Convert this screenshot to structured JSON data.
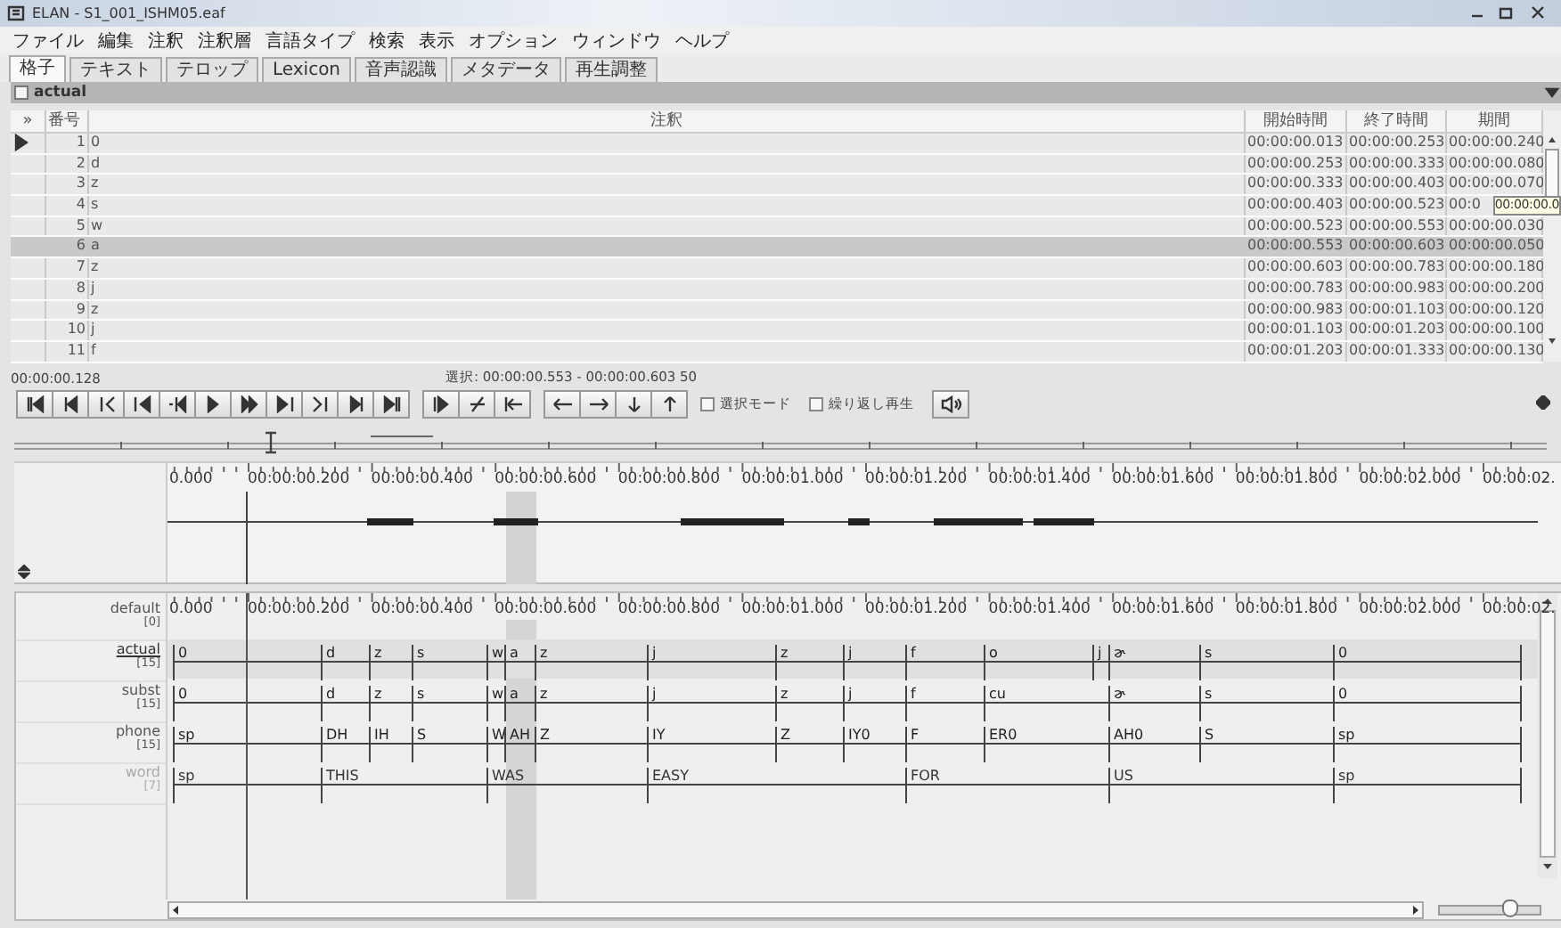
{
  "window": {
    "title": "ELAN - S1_001_ISHM05.eaf"
  },
  "menu": [
    "ファイル",
    "編集",
    "注釈",
    "注釈層",
    "言語タイプ",
    "検索",
    "表示",
    "オプション",
    "ウィンドウ",
    "ヘルプ"
  ],
  "tabs": [
    {
      "label": "格子",
      "selected": true
    },
    {
      "label": "テキスト",
      "selected": false
    },
    {
      "label": "テロップ",
      "selected": false
    },
    {
      "label": "Lexicon",
      "selected": false
    },
    {
      "label": "音声認識",
      "selected": false
    },
    {
      "label": "メタデータ",
      "selected": false
    },
    {
      "label": "再生調整",
      "selected": false
    }
  ],
  "grid": {
    "tier": "actual",
    "tier_checked": false,
    "columns": [
      "»",
      "番号",
      "注釈",
      "開始時間",
      "終了時間",
      "期間"
    ],
    "rows": [
      {
        "number": "1",
        "annotation": "0",
        "begin": "00:00:00.013",
        "end": "00:00:00.253",
        "duration": "00:00:00.240",
        "selected": false,
        "current": true
      },
      {
        "number": "2",
        "annotation": "d",
        "begin": "00:00:00.253",
        "end": "00:00:00.333",
        "duration": "00:00:00.080",
        "selected": false,
        "current": false
      },
      {
        "number": "3",
        "annotation": "z",
        "begin": "00:00:00.333",
        "end": "00:00:00.403",
        "duration": "00:00:00.070",
        "selected": false,
        "current": false
      },
      {
        "number": "4",
        "annotation": "s",
        "begin": "00:00:00.403",
        "end": "00:00:00.523",
        "duration": "00:0",
        "selected": false,
        "current": false
      },
      {
        "number": "5",
        "annotation": "w",
        "begin": "00:00:00.523",
        "end": "00:00:00.553",
        "duration": "00:00:00.030",
        "selected": false,
        "current": false
      },
      {
        "number": "6",
        "annotation": "a",
        "begin": "00:00:00.553",
        "end": "00:00:00.603",
        "duration": "00:00:00.050",
        "selected": true,
        "current": false
      },
      {
        "number": "7",
        "annotation": "z",
        "begin": "00:00:00.603",
        "end": "00:00:00.783",
        "duration": "00:00:00.180",
        "selected": false,
        "current": false
      },
      {
        "number": "8",
        "annotation": "j",
        "begin": "00:00:00.783",
        "end": "00:00:00.983",
        "duration": "00:00:00.200",
        "selected": false,
        "current": false
      },
      {
        "number": "9",
        "annotation": "z",
        "begin": "00:00:00.983",
        "end": "00:00:01.103",
        "duration": "00:00:00.120",
        "selected": false,
        "current": false
      },
      {
        "number": "10",
        "annotation": "j",
        "begin": "00:00:01.103",
        "end": "00:00:01.203",
        "duration": "00:00:00.100",
        "selected": false,
        "current": false
      },
      {
        "number": "11",
        "annotation": "f",
        "begin": "00:00:01.203",
        "end": "00:00:01.333",
        "duration": "00:00:00.130",
        "selected": false,
        "current": false
      }
    ],
    "tooltip": "00:00:00.0"
  },
  "status": {
    "time": "00:00:00.128",
    "selection": "選択: 00:00:00.553 - 00:00:00.603  50"
  },
  "checkboxes": [
    {
      "label": "選択モード",
      "checked": false
    },
    {
      "label": "繰り返し再生",
      "checked": false
    }
  ],
  "waveform": {
    "ruler": [
      "0.000",
      "00:00:00.200",
      "00:00:00.400",
      "00:00:00.600",
      "00:00:00.800",
      "00:00:01.000",
      "00:00:01.200",
      "00:00:01.400",
      "00:00:01.600",
      "00:00:01.800",
      "00:00:02.000",
      "00:00:02."
    ]
  },
  "timeline": {
    "ruler": [
      "0.000",
      "00:00:00.200",
      "00:00:00.400",
      "00:00:00.600",
      "00:00:00.800",
      "00:00:01.000",
      "00:00:01.200",
      "00:00:01.400",
      "00:00:01.600",
      "00:00:01.800",
      "00:00:02.000",
      "00:00:02."
    ],
    "tiers": [
      {
        "name": "default",
        "count": "[0]",
        "active": false,
        "greyed": false
      },
      {
        "name": "actual",
        "count": "[15]",
        "active": true,
        "greyed": false,
        "annotations": [
          "0",
          "d",
          "z",
          "s",
          "w",
          "a",
          "z",
          "j",
          "z",
          "j",
          "f",
          "o",
          "j",
          "ɚ",
          "s",
          "0"
        ]
      },
      {
        "name": "subst",
        "count": "[15]",
        "active": false,
        "greyed": false,
        "annotations": [
          "0",
          "d",
          "z",
          "s",
          "w",
          "a",
          "z",
          "j",
          "z",
          "j",
          "f",
          "cu",
          "ɚ",
          "s",
          "0"
        ]
      },
      {
        "name": "phone",
        "count": "[15]",
        "active": false,
        "greyed": false,
        "annotations": [
          "sp",
          "DH",
          "IH",
          "S",
          "W",
          "AH",
          "Z",
          "IY",
          "Z",
          "IY0",
          "F",
          "ER0",
          "AH0",
          "S",
          "sp"
        ]
      },
      {
        "name": "word",
        "count": "[7]",
        "active": false,
        "greyed": true,
        "annotations": [
          "sp",
          "THIS",
          "WAS",
          "EASY",
          "FOR",
          "US",
          "sp"
        ]
      }
    ],
    "zoom_slider": {
      "level": 0.72
    }
  }
}
